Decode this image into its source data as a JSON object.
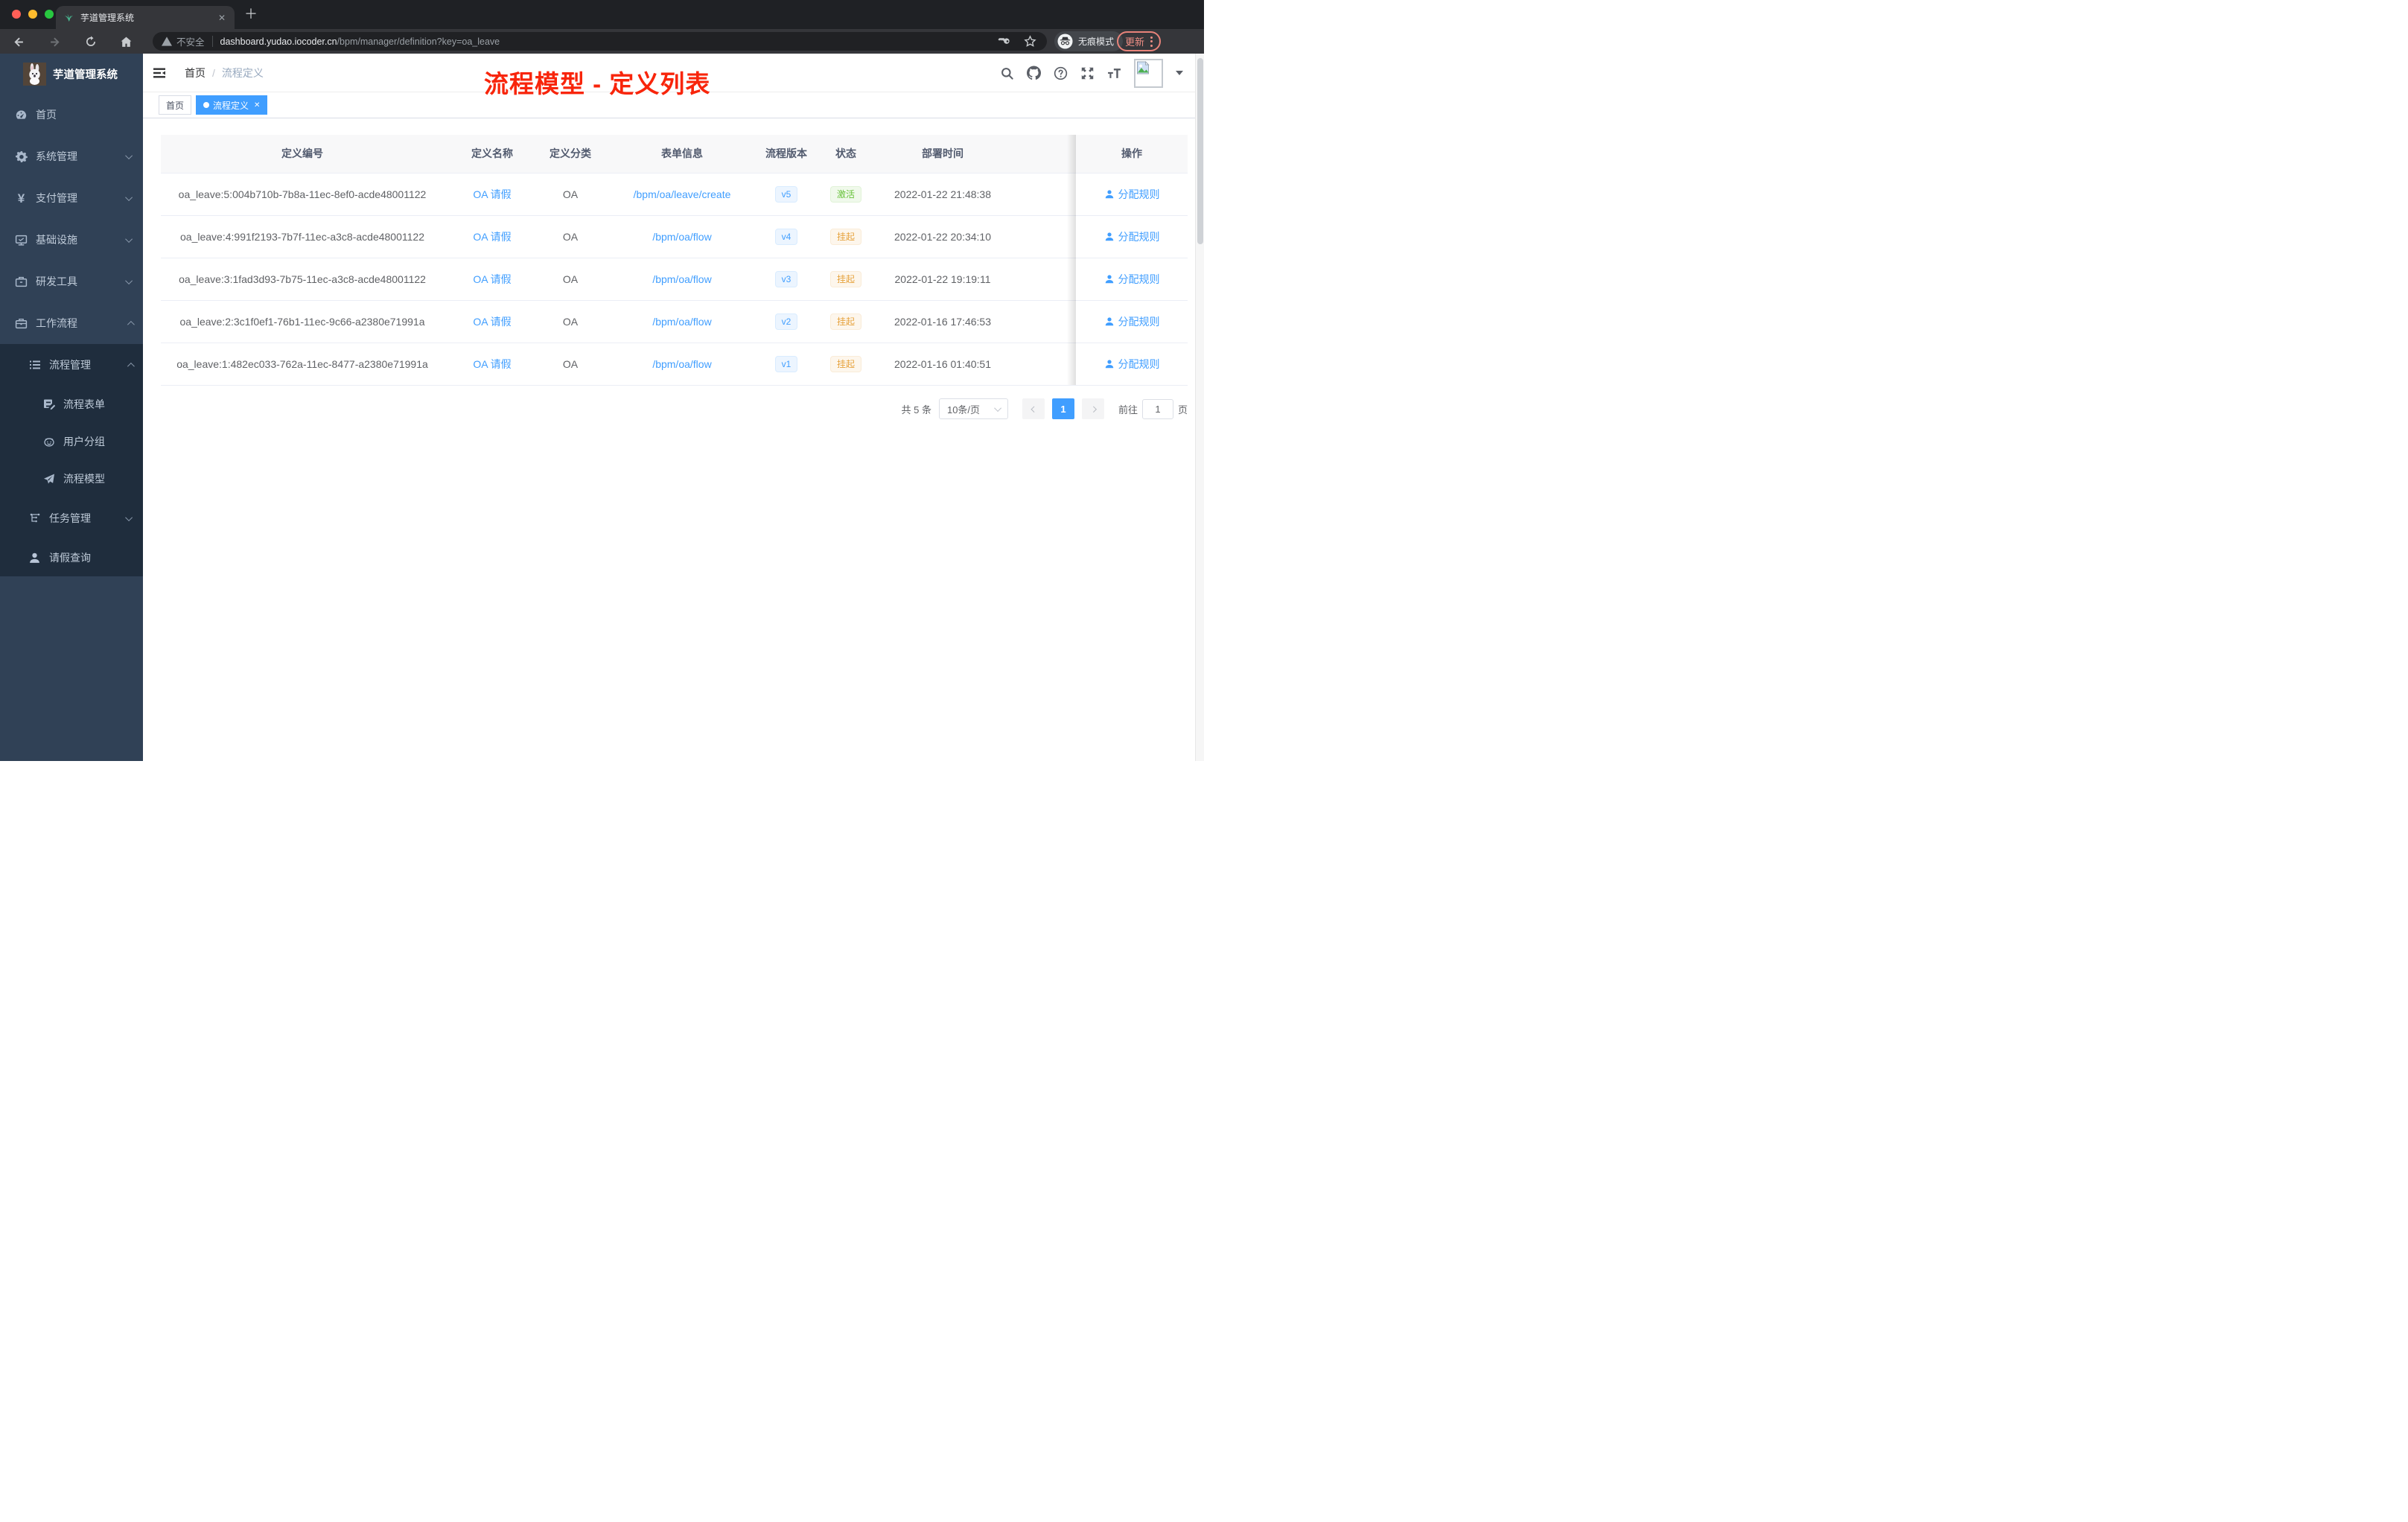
{
  "colors": {
    "accent": "#409eff",
    "annotation_red": "#f8250b",
    "success": "#67c23a",
    "warning": "#e6a23c",
    "sidebar_bg": "#304156",
    "submenu_bg": "#1f2d3d"
  },
  "browser": {
    "tab_title": "芋道管理系统",
    "security_label": "不安全",
    "url_host": "dashboard.yudao.iocoder.cn",
    "url_path": "/bpm/manager/definition?key=oa_leave",
    "incognito_label": "无痕模式",
    "update_label": "更新"
  },
  "icons": {
    "close": "✕",
    "plus": "＋"
  },
  "sidebar": {
    "logo_title": "芋道管理系统",
    "menu": [
      {
        "label": "首页"
      },
      {
        "label": "系统管理"
      },
      {
        "label": "支付管理"
      },
      {
        "label": "基础设施"
      },
      {
        "label": "研发工具"
      },
      {
        "label": "工作流程"
      }
    ],
    "submenu": [
      {
        "label": "流程管理"
      },
      {
        "label": "流程表单"
      },
      {
        "label": "用户分组"
      },
      {
        "label": "流程模型"
      },
      {
        "label": "任务管理"
      },
      {
        "label": "请假查询"
      }
    ]
  },
  "navbar": {
    "breadcrumb_home": "首页",
    "breadcrumb_separator": "/",
    "breadcrumb_current": "流程定义"
  },
  "annotation": "流程模型 - 定义列表",
  "tags": {
    "home": "首页",
    "active": "流程定义"
  },
  "table": {
    "headers": [
      "定义编号",
      "定义名称",
      "定义分类",
      "表单信息",
      "流程版本",
      "状态",
      "部署时间",
      "操作"
    ],
    "action_label": "分配规则",
    "rows": [
      {
        "id": "oa_leave:5:004b710b-7b8a-11ec-8ef0-acde48001122",
        "name": "OA 请假",
        "category": "OA",
        "form": "/bpm/oa/leave/create",
        "version": "v5",
        "status": "激活",
        "time": "2022-01-22 21:48:38"
      },
      {
        "id": "oa_leave:4:991f2193-7b7f-11ec-a3c8-acde48001122",
        "name": "OA 请假",
        "category": "OA",
        "form": "/bpm/oa/flow",
        "version": "v4",
        "status": "挂起",
        "time": "2022-01-22 20:34:10"
      },
      {
        "id": "oa_leave:3:1fad3d93-7b75-11ec-a3c8-acde48001122",
        "name": "OA 请假",
        "category": "OA",
        "form": "/bpm/oa/flow",
        "version": "v3",
        "status": "挂起",
        "time": "2022-01-22 19:19:11"
      },
      {
        "id": "oa_leave:2:3c1f0ef1-76b1-11ec-9c66-a2380e71991a",
        "name": "OA 请假",
        "category": "OA",
        "form": "/bpm/oa/flow",
        "version": "v2",
        "status": "挂起",
        "time": "2022-01-16 17:46:53"
      },
      {
        "id": "oa_leave:1:482ec033-762a-11ec-8477-a2380e71991a",
        "name": "OA 请假",
        "category": "OA",
        "form": "/bpm/oa/flow",
        "version": "v1",
        "status": "挂起",
        "time": "2022-01-16 01:40:51"
      }
    ]
  },
  "pagination": {
    "total": "共 5 条",
    "page_size": "10条/页",
    "current_page": "1",
    "goto_label": "前往",
    "goto_value": "1",
    "unit_label": "页"
  }
}
